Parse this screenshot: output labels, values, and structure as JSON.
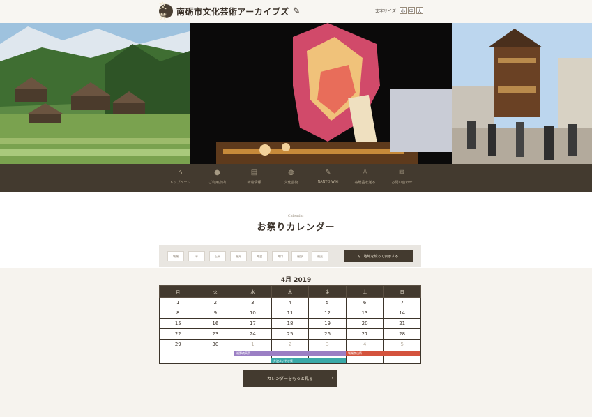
{
  "site": {
    "logo_mark": "文芸",
    "title": "南砺市文化芸術アーカイブズ",
    "font_size_label": "文字サイズ",
    "font_sizes": [
      "小",
      "中",
      "大"
    ]
  },
  "nav": {
    "items": [
      {
        "label": "トップページ",
        "icon": "home-icon"
      },
      {
        "label": "ご利用案内",
        "icon": "info-icon"
      },
      {
        "label": "新着情報",
        "icon": "news-icon"
      },
      {
        "label": "文化芸術",
        "icon": "culture-icon"
      },
      {
        "label": "NANTO Wiki",
        "icon": "pencil-icon"
      },
      {
        "label": "寄贈品を送る",
        "icon": "people-icon"
      },
      {
        "label": "お問い合わせ",
        "icon": "mail-icon"
      }
    ]
  },
  "calendar_section": {
    "subtitle": "Calendar",
    "title": "お祭りカレンダー",
    "regions": [
      "城端",
      "平",
      "上平",
      "福光",
      "井波",
      "井口",
      "福野",
      "福光"
    ],
    "filter_button": "地域を絞って表示する",
    "month_label": "4月 2019",
    "weekdays": [
      "月",
      "火",
      "水",
      "木",
      "金",
      "土",
      "日"
    ],
    "weeks": [
      [
        "1",
        "2",
        "3",
        "4",
        "5",
        "6",
        "7"
      ],
      [
        "8",
        "9",
        "10",
        "11",
        "12",
        "13",
        "14"
      ],
      [
        "15",
        "16",
        "17",
        "18",
        "19",
        "20",
        "21"
      ],
      [
        "22",
        "23",
        "24",
        "25",
        "26",
        "27",
        "28"
      ],
      [
        "29",
        "30",
        "1",
        "2",
        "3",
        "4",
        "5"
      ]
    ],
    "events": [
      {
        "label": "福野夜高祭",
        "color": "#9b7fc4"
      },
      {
        "label": "井波よいやさ祭",
        "color": "#3aa9a8"
      },
      {
        "label": "城端曳山祭",
        "color": "#d4533d"
      }
    ],
    "more_button": "カレンダーをもっと見る",
    "more_arrow": "›"
  },
  "colors": {
    "dark_brown": "#433a2f",
    "background": "#f6f3ee"
  }
}
